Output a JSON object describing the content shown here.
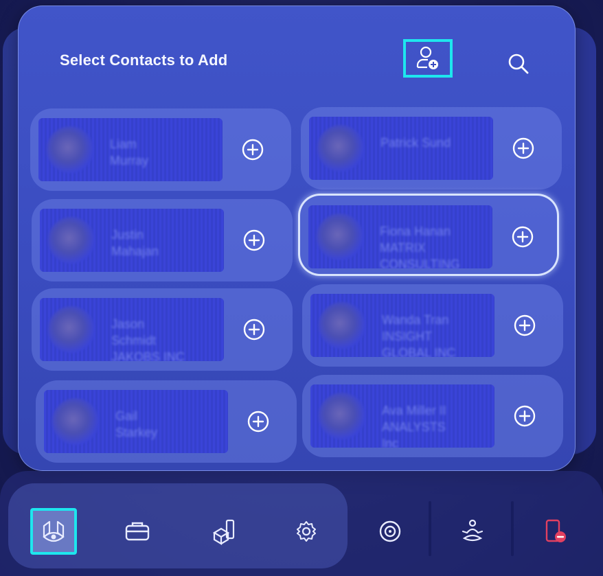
{
  "panel": {
    "title": "Select Contacts to Add",
    "add_contact_icon": "person-add-icon",
    "search_icon": "search-icon"
  },
  "contacts": [
    {
      "name": "Liam\nMurray",
      "icon": "plus-circle-icon",
      "selected": false
    },
    {
      "name": "Patrick Sund",
      "icon": "plus-circle-icon",
      "selected": false
    },
    {
      "name": "Justin\nMahajan",
      "icon": "plus-circle-icon",
      "selected": false
    },
    {
      "name": "Fiona Hanan\nMATRIX\nCONSULTING",
      "icon": "plus-circle-icon",
      "selected": true
    },
    {
      "name": "Jason\nSchmidt\nJAKOBS INC",
      "icon": "plus-circle-icon",
      "selected": false
    },
    {
      "name": "Wanda Tran\nINSIGHT\nGLOBAL INC",
      "icon": "plus-circle-icon",
      "selected": false
    },
    {
      "name": "Gail\nStarkey",
      "icon": "plus-circle-icon",
      "selected": false
    },
    {
      "name": "Ava Miller II\nANALYSTS\nInc",
      "icon": "plus-circle-icon",
      "selected": false
    }
  ],
  "dock": {
    "items": [
      {
        "name": "view-icon",
        "active": true
      },
      {
        "name": "toolbox-icon",
        "active": false
      },
      {
        "name": "3d-objects-icon",
        "active": false
      },
      {
        "name": "settings-icon",
        "active": false
      },
      {
        "name": "target-icon",
        "active": false
      },
      {
        "name": "meditation-icon",
        "active": false
      },
      {
        "name": "leave-call-icon",
        "active": false
      }
    ],
    "accent_color": "#1ee6ee",
    "leave_color": "#e24060"
  }
}
